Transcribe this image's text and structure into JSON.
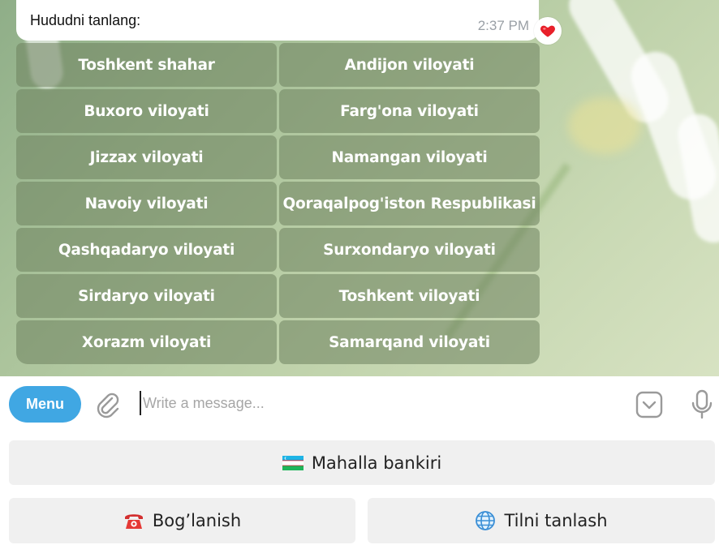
{
  "message": {
    "text": "Hududni tanlang:",
    "time": "2:37 PM",
    "reaction_icon": "heart-icon"
  },
  "inline_keyboard": [
    [
      "Toshkent shahar",
      "Andijon viloyati"
    ],
    [
      "Buxoro viloyati",
      "Farg'ona viloyati"
    ],
    [
      "Jizzax viloyati",
      "Namangan viloyati"
    ],
    [
      "Navoiy viloyati",
      "Qoraqalpog'iston Respublikasi"
    ],
    [
      "Qashqadaryo viloyati",
      "Surxondaryo viloyati"
    ],
    [
      "Sirdaryo viloyati",
      "Toshkent viloyati"
    ],
    [
      "Xorazm viloyati",
      "Samarqand viloyati"
    ]
  ],
  "composer": {
    "menu_label": "Menu",
    "placeholder": "Write a message...",
    "accent_color": "#40a7e3"
  },
  "reply_keyboard": {
    "mahalla": "Mahalla bankiri",
    "contact": "Bog’lanish",
    "language": "Tilni tanlash"
  }
}
